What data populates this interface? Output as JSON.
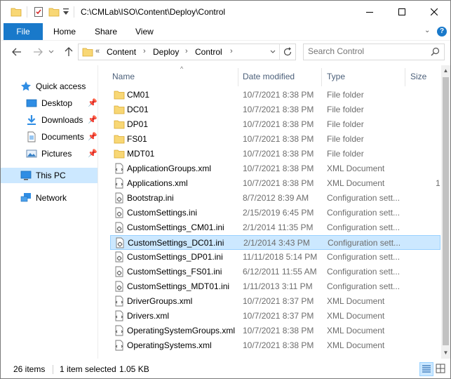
{
  "window": {
    "title": "C:\\CMLab\\ISO\\Content\\Deploy\\Control",
    "quick_access_toolbar": [
      "folder-icon",
      "properties-icon",
      "new-folder-icon",
      "customize-dropdown-icon"
    ],
    "controls": [
      "minimize-icon",
      "maximize-icon",
      "close-icon"
    ]
  },
  "ribbon": {
    "file_label": "File",
    "tabs": [
      "Home",
      "Share",
      "View"
    ],
    "help_label": "?",
    "accent": "#1979ca"
  },
  "address": {
    "overflow": "«",
    "crumbs": [
      "Content",
      "Deploy",
      "Control"
    ],
    "refresh_icon": "refresh-icon"
  },
  "search": {
    "placeholder": "Search Control"
  },
  "nav": {
    "items": [
      {
        "label": "Quick access",
        "icon": "star-icon",
        "pinned": false
      },
      {
        "label": "Desktop",
        "icon": "desktop-icon",
        "pinned": true
      },
      {
        "label": "Downloads",
        "icon": "download-icon",
        "pinned": true
      },
      {
        "label": "Documents",
        "icon": "documents-icon",
        "pinned": true
      },
      {
        "label": "Pictures",
        "icon": "pictures-icon",
        "pinned": true
      },
      {
        "label": "This PC",
        "icon": "computer-icon",
        "pinned": false,
        "selected": true
      },
      {
        "label": "Network",
        "icon": "network-icon",
        "pinned": false
      }
    ]
  },
  "list": {
    "columns": [
      "Name",
      "Date modified",
      "Type",
      "Size"
    ],
    "sort_indicator": "^",
    "rows": [
      {
        "name": "CM01",
        "date": "10/7/2021 8:38 PM",
        "type": "File folder",
        "size": "",
        "kind": "folder"
      },
      {
        "name": "DC01",
        "date": "10/7/2021 8:38 PM",
        "type": "File folder",
        "size": "",
        "kind": "folder"
      },
      {
        "name": "DP01",
        "date": "10/7/2021 8:38 PM",
        "type": "File folder",
        "size": "",
        "kind": "folder"
      },
      {
        "name": "FS01",
        "date": "10/7/2021 8:38 PM",
        "type": "File folder",
        "size": "",
        "kind": "folder"
      },
      {
        "name": "MDT01",
        "date": "10/7/2021 8:38 PM",
        "type": "File folder",
        "size": "",
        "kind": "folder"
      },
      {
        "name": "ApplicationGroups.xml",
        "date": "10/7/2021 8:38 PM",
        "type": "XML Document",
        "size": "",
        "kind": "xml"
      },
      {
        "name": "Applications.xml",
        "date": "10/7/2021 8:38 PM",
        "type": "XML Document",
        "size": "1",
        "kind": "xml"
      },
      {
        "name": "Bootstrap.ini",
        "date": "8/7/2012 8:39 AM",
        "type": "Configuration sett...",
        "size": "",
        "kind": "ini"
      },
      {
        "name": "CustomSettings.ini",
        "date": "2/15/2019 6:45 PM",
        "type": "Configuration sett...",
        "size": "",
        "kind": "ini"
      },
      {
        "name": "CustomSettings_CM01.ini",
        "date": "2/1/2014 11:35 PM",
        "type": "Configuration sett...",
        "size": "",
        "kind": "ini"
      },
      {
        "name": "CustomSettings_DC01.ini",
        "date": "2/1/2014 3:43 PM",
        "type": "Configuration sett...",
        "size": "",
        "kind": "ini",
        "selected": true
      },
      {
        "name": "CustomSettings_DP01.ini",
        "date": "11/11/2018 5:14 PM",
        "type": "Configuration sett...",
        "size": "",
        "kind": "ini"
      },
      {
        "name": "CustomSettings_FS01.ini",
        "date": "6/12/2011 11:55 AM",
        "type": "Configuration sett...",
        "size": "",
        "kind": "ini"
      },
      {
        "name": "CustomSettings_MDT01.ini",
        "date": "1/11/2013 3:11 PM",
        "type": "Configuration sett...",
        "size": "",
        "kind": "ini"
      },
      {
        "name": "DriverGroups.xml",
        "date": "10/7/2021 8:37 PM",
        "type": "XML Document",
        "size": "",
        "kind": "xml"
      },
      {
        "name": "Drivers.xml",
        "date": "10/7/2021 8:37 PM",
        "type": "XML Document",
        "size": "",
        "kind": "xml"
      },
      {
        "name": "OperatingSystemGroups.xml",
        "date": "10/7/2021 8:38 PM",
        "type": "XML Document",
        "size": "",
        "kind": "xml"
      },
      {
        "name": "OperatingSystems.xml",
        "date": "10/7/2021 8:38 PM",
        "type": "XML Document",
        "size": "",
        "kind": "xml"
      }
    ]
  },
  "status": {
    "item_count": "26 items",
    "selection": "1 item selected",
    "selection_size": "1.05 KB",
    "views": [
      "details-view-icon",
      "large-icons-view-icon"
    ]
  }
}
